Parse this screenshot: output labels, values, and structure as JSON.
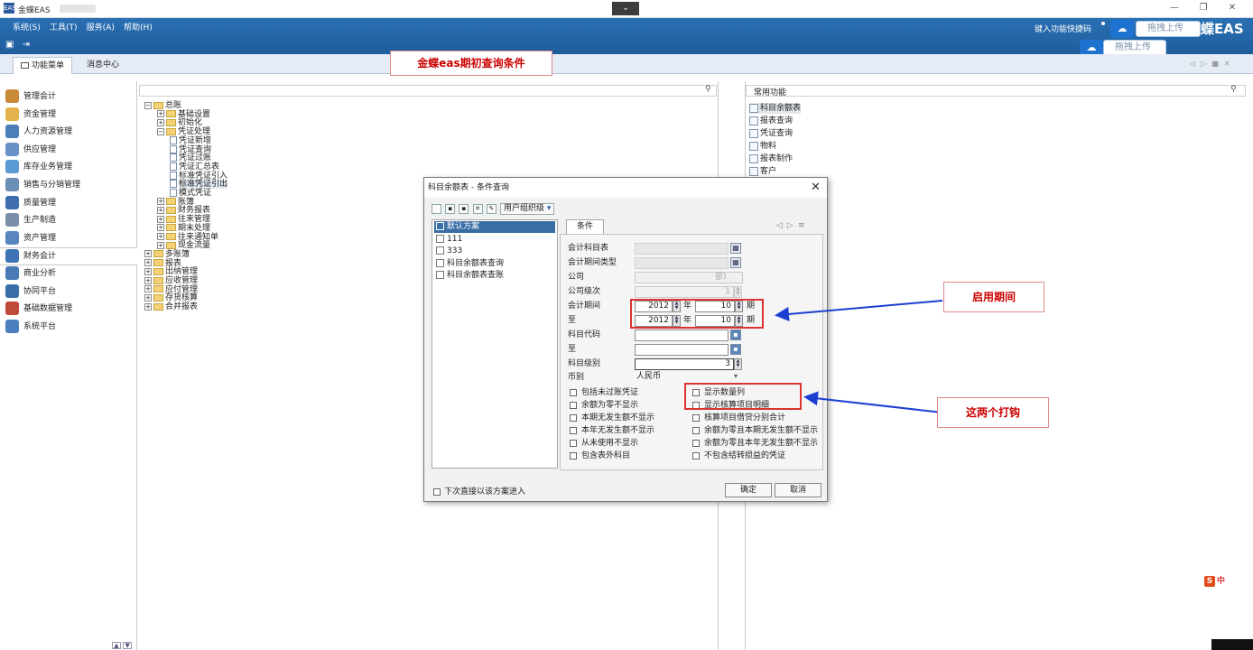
{
  "window": {
    "app_title": "金蝶EAS",
    "dropdown_glyph": "⌄",
    "minimize": "—",
    "restore": "❐",
    "close": "✕"
  },
  "menu": {
    "items": [
      "系统(S)",
      "工具(T)",
      "服务(A)",
      "帮助(H)"
    ],
    "quick_key": "键入功能快捷码",
    "brand": "蝶EAS",
    "upload_label": "拖拽上传"
  },
  "tabs": [
    {
      "label": "功能菜单",
      "active": true
    },
    {
      "label": "消息中心",
      "active": false
    }
  ],
  "tab_nav": "◁▷■✕",
  "sidebar": {
    "items": [
      {
        "label": "管理会计",
        "color": "#c98b3a"
      },
      {
        "label": "资金管理",
        "color": "#e3b24a"
      },
      {
        "label": "人力资源管理",
        "color": "#4c7fb8"
      },
      {
        "label": "供应管理",
        "color": "#6a90c8"
      },
      {
        "label": "库存业务管理",
        "color": "#5a9bd5"
      },
      {
        "label": "销售与分销管理",
        "color": "#6b8fb4"
      },
      {
        "label": "质量管理",
        "color": "#3f6fb0"
      },
      {
        "label": "生产制造",
        "color": "#7a8fa8"
      },
      {
        "label": "资产管理",
        "color": "#5a86c0"
      },
      {
        "label": "财务会计",
        "color": "#3e73b5",
        "active": true
      },
      {
        "label": "商业分析",
        "color": "#4b7bb6"
      },
      {
        "label": "协同平台",
        "color": "#3b6ea8"
      },
      {
        "label": "基础数据管理",
        "color": "#c04a3a"
      },
      {
        "label": "系统平台",
        "color": "#4d7fbe"
      }
    ]
  },
  "tree": {
    "nodes": [
      {
        "label": "总账",
        "exp": "−"
      },
      {
        "label": "基础设置",
        "exp": "+"
      },
      {
        "label": "初始化",
        "exp": "+"
      },
      {
        "label": "凭证处理",
        "exp": "−"
      },
      {
        "label": "凭证新增"
      },
      {
        "label": "凭证查询"
      },
      {
        "label": "凭证过账"
      },
      {
        "label": "凭证汇总表"
      },
      {
        "label": "标准凭证引入"
      },
      {
        "label": "标准凭证引出"
      },
      {
        "label": "模式凭证"
      },
      {
        "label": "账簿",
        "exp": "+"
      },
      {
        "label": "财务报表",
        "exp": "+"
      },
      {
        "label": "往来管理",
        "exp": "+"
      },
      {
        "label": "期末处理",
        "exp": "+"
      },
      {
        "label": "往来通知单",
        "exp": "+"
      },
      {
        "label": "现金流量",
        "exp": "+"
      },
      {
        "label": "多账簿",
        "exp": "+"
      },
      {
        "label": "报表",
        "exp": "+"
      },
      {
        "label": "出纳管理",
        "exp": "+"
      },
      {
        "label": "应收管理",
        "exp": "+"
      },
      {
        "label": "应付管理",
        "exp": "+"
      },
      {
        "label": "存货核算",
        "exp": "+"
      },
      {
        "label": "合并报表",
        "exp": "+"
      }
    ]
  },
  "favorites": {
    "title": "常用功能",
    "items": [
      "科目余额表",
      "报表查询",
      "凭证查询",
      "物料",
      "报表制作",
      "客户"
    ]
  },
  "annotations": {
    "title": "金蝶eas期初查询条件",
    "period_note": "启用期间",
    "check_note": "这两个打钩"
  },
  "dialog": {
    "title": "科目余额表 - 条件查询",
    "close": "✕",
    "org_button": "用户组织级",
    "schemes": [
      "默认方案",
      "111",
      "333",
      "科目余额表查询",
      "科目余额表查账"
    ],
    "cond_tab": "条件",
    "cond_nav": "◁▷≡",
    "labels": {
      "account_table": "会计科目表",
      "period_type": "会计期间类型",
      "company": "公司",
      "company_level": "公司级次",
      "period": "会计期间",
      "to": "至",
      "account_code": "科目代码",
      "account_code_to": "至",
      "account_level": "科目级别",
      "currency": "币别"
    },
    "values": {
      "company_suffix": "部)",
      "company_level": "1",
      "from_year": "2012",
      "from_period": "10",
      "to_year": "2012",
      "to_period": "10",
      "year_unit": "年",
      "period_unit": "期",
      "account_level": "3",
      "currency": "人民币"
    },
    "checks_left": [
      "包括未过账凭证",
      "余额为零不显示",
      "本期无发生额不显示",
      "本年无发生额不显示",
      "从未使用不显示",
      "包含表外科目"
    ],
    "checks_right": [
      "显示数量列",
      "显示核算项目明细",
      "核算项目借贷分别合计",
      "余额为零且本期无发生额不显示",
      "余额为零且本年无发生额不显示",
      "不包含结转损益的凭证"
    ],
    "next_time": "下次直接以该方案进入",
    "ok": "确定",
    "cancel": "取消"
  },
  "ime": "中"
}
